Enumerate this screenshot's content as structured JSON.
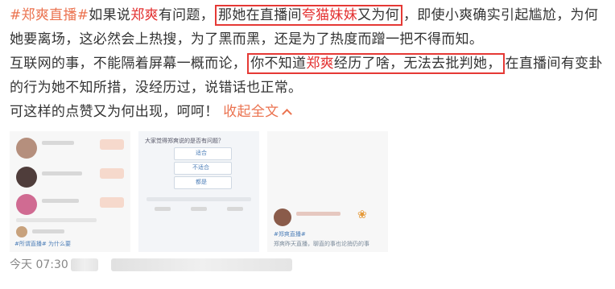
{
  "post": {
    "line1": {
      "hashtag": "#郑爽直播#",
      "t1": "如果说",
      "name": "郑爽",
      "t2": "有问题，",
      "box_t1": "那她在直播间",
      "box_red": "夸猫妹妹",
      "box_t2": "又为何",
      "t3": "，即使小爽确实引起尴尬，为何",
      "t4": "她要离场，这必然会上热搜，为了黑而黑，还是为了热度而蹭一把不得而知。"
    },
    "line2": {
      "t1": "互联网的事，不能隔着屏幕一概而论，",
      "box_t1": "你不知道",
      "box_red": "郑爽",
      "box_t2": "经历了啥，无法去批判她，",
      "t2": "在直播间有变卦",
      "t3": "的行为她不知所措，没经历过，说错话也正常。"
    },
    "line3": {
      "text": "可这样的点赞又为何出现，呵呵！",
      "collapse_label": "收起全文"
    }
  },
  "thumbnails": [
    {
      "caption": "#所谓直播# 为什么要"
    },
    {
      "question": "大家觉得郑爽说的是否有问题？",
      "options": [
        "适合",
        "不适合",
        "都是"
      ]
    },
    {
      "caption": "#郑爽直播#",
      "body": "郑爽昨天直播，聊直的事也论捎仍的事"
    }
  ],
  "footer": {
    "time": "今天 07:30"
  },
  "colors": {
    "accent": "#eb7350",
    "highlight_red": "#e33030",
    "box_border": "#e53935"
  }
}
